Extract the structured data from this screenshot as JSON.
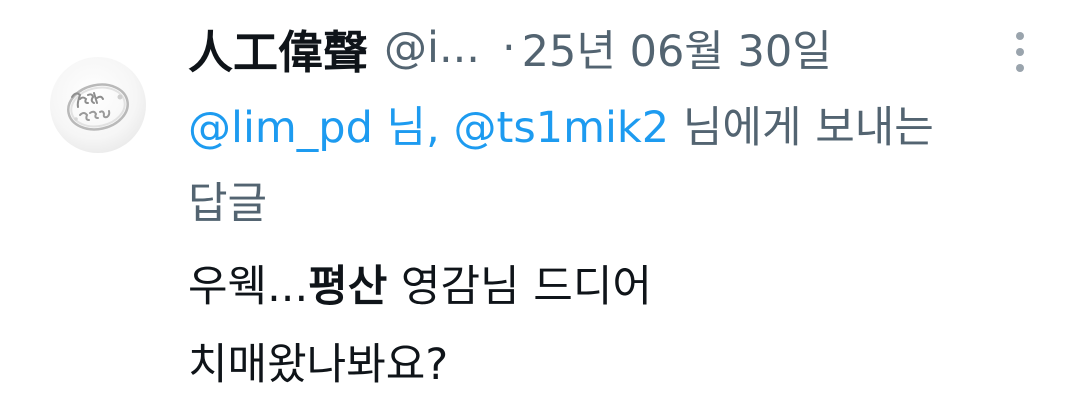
{
  "tweet": {
    "display_name": "人工偉聲",
    "handle": "@i...",
    "separator": "·",
    "timestamp": "25년 06월 30일",
    "avatar_icon": "ring-avatar",
    "more_icon": "vertical-ellipsis-icon",
    "reply_to": {
      "mention_1": "@lim_pd",
      "joiner": " 님, ",
      "mention_2": "@ts1mik2",
      "suffix": " 님에게 보내는 답글"
    },
    "body": {
      "part_1": "우웩...",
      "bold": "평산",
      "part_2": " 영감님 드디어",
      "line_2": "치매왔나봐요?"
    }
  },
  "colors": {
    "text_primary": "#0f1419",
    "text_secondary": "#536471",
    "link": "#1d9bf0"
  }
}
